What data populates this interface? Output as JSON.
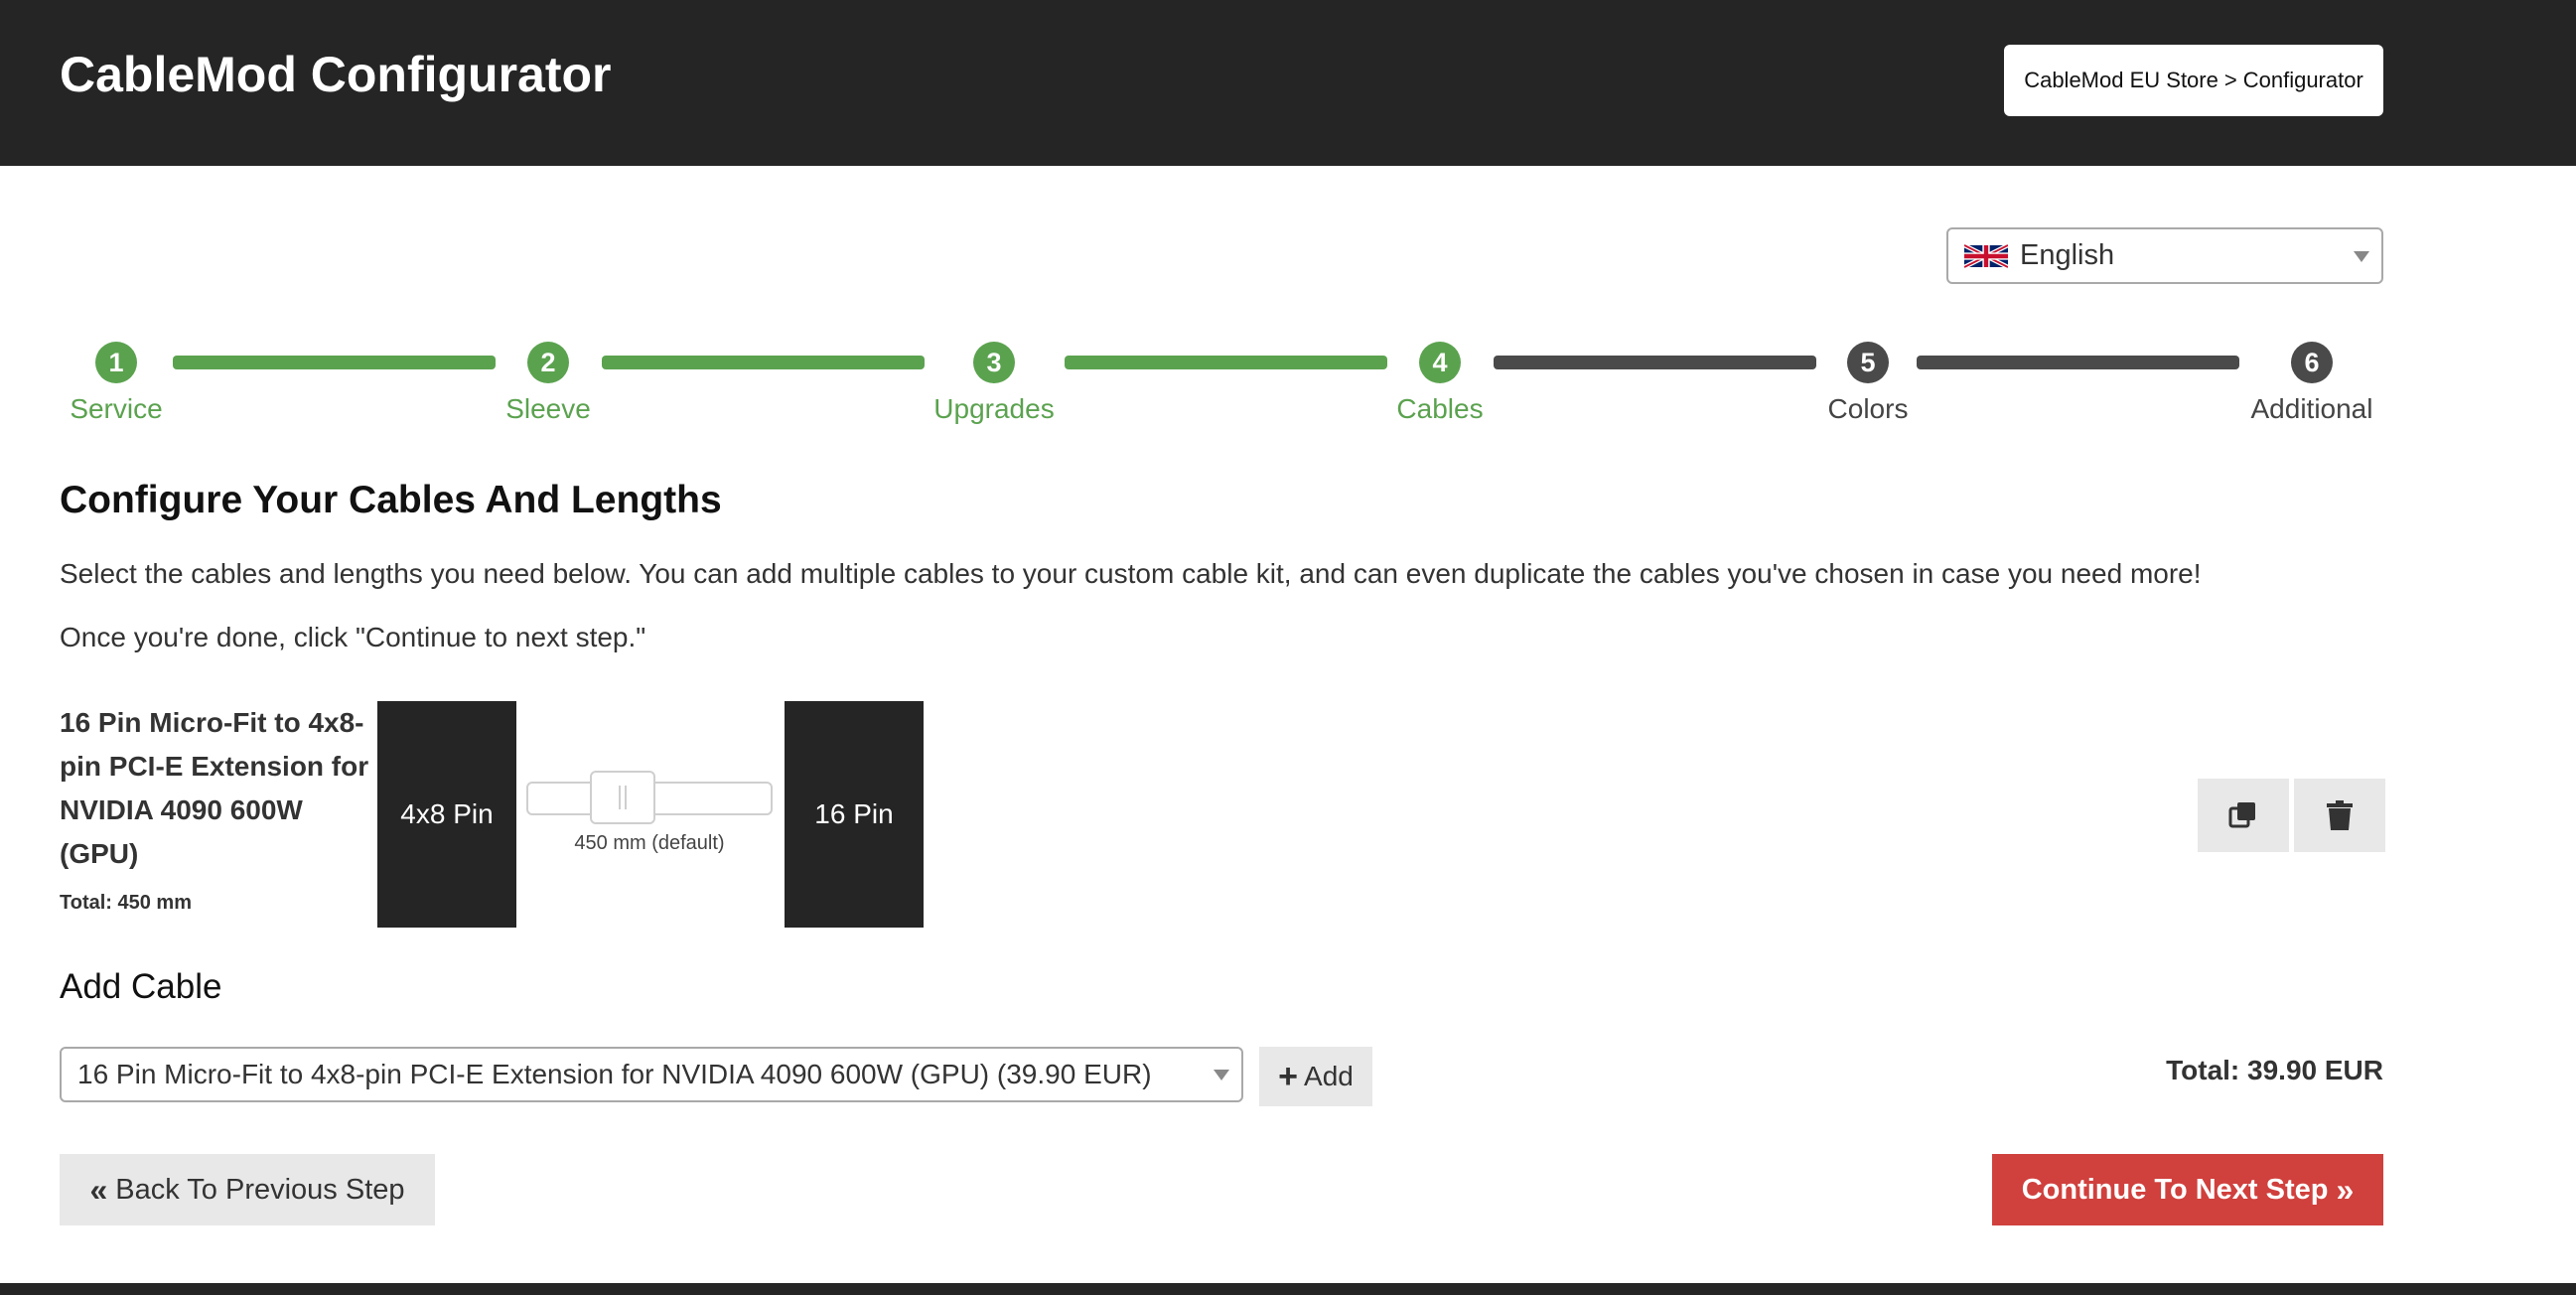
{
  "header": {
    "title": "CableMod Configurator",
    "breadcrumb": {
      "store": "CableMod EU Store",
      "separator": ">",
      "current": "Configurator"
    }
  },
  "language": {
    "selected": "English",
    "flag_icon": "uk-flag-icon"
  },
  "steps": [
    {
      "number": "1",
      "label": "Service",
      "state": "done"
    },
    {
      "number": "2",
      "label": "Sleeve",
      "state": "done"
    },
    {
      "number": "3",
      "label": "Upgrades",
      "state": "done"
    },
    {
      "number": "4",
      "label": "Cables",
      "state": "done"
    },
    {
      "number": "5",
      "label": "Colors",
      "state": "todo"
    },
    {
      "number": "6",
      "label": "Additional",
      "state": "todo"
    }
  ],
  "main": {
    "title": "Configure Your Cables And Lengths",
    "intro1": "Select the cables and lengths you need below. You can add multiple cables to your custom cable kit, and can even duplicate the cables you've chosen in case you need more!",
    "intro2": "Once you're done, click \"Continue to next step.\""
  },
  "cable": {
    "name": "16 Pin Micro-Fit to 4x8-pin PCI-E Extension for NVIDIA 4090 600W (GPU)",
    "total": "Total: 450 mm",
    "left_connector": "4x8 Pin",
    "right_connector": "16 Pin",
    "length_label": "450 mm (default)",
    "duplicate_icon": "copy-icon",
    "delete_icon": "trash-icon"
  },
  "add_cable": {
    "title": "Add Cable",
    "selected_option": "16 Pin Micro-Fit to 4x8-pin PCI-E Extension for NVIDIA 4090 600W (GPU) (39.90 EUR)",
    "add_label": "Add"
  },
  "total": "Total: 39.90 EUR",
  "nav": {
    "back_label": "Back To Previous Step",
    "next_label": "Continue To Next Step"
  },
  "colors": {
    "header_bg": "#252525",
    "step_done": "#5ba24f",
    "step_todo": "#4a4a4a",
    "primary_button": "#d0403d",
    "secondary_button": "#e8e8e8"
  }
}
